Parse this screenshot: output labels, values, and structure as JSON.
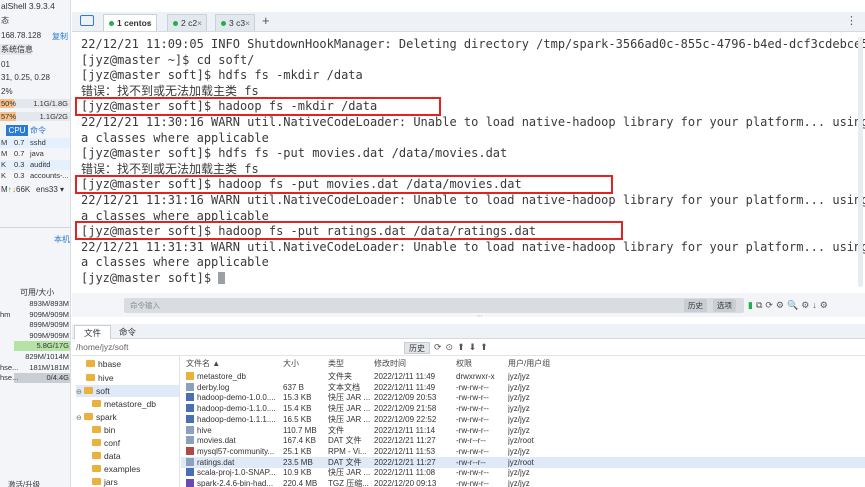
{
  "sidebar": {
    "app_title": "alShell 3.9.3.4",
    "status_label": "态",
    "ip": "168.78.128",
    "copy_label": "复制",
    "sysinfo_label": "系统信息",
    "uptime": "01",
    "load": "31, 0.25, 0.28",
    "cpu_pct": "2%",
    "mem_pct": "50%",
    "mem_val": "1.1G/1.8G",
    "swap_pct": "57%",
    "swap_val": "1.1G/2G",
    "proc_tab_cpu": "CPU",
    "proc_tab_cmd": "命令",
    "processes": [
      {
        "mem": "M",
        "cpu": "0.7",
        "name": "sshd"
      },
      {
        "mem": "M",
        "cpu": "0.7",
        "name": "java"
      },
      {
        "mem": "K",
        "cpu": "0.3",
        "name": "auditd"
      },
      {
        "mem": "K",
        "cpu": "0.3",
        "name": "accounts-..."
      }
    ],
    "net_up": "M",
    "net_down": "66K",
    "net_iface": "ens33",
    "local_label": "本机",
    "disk_header": "可用/大小",
    "disks": [
      {
        "name": "",
        "val": "893M/893M"
      },
      {
        "name": "hm",
        "val": "909M/909M"
      },
      {
        "name": "",
        "val": "899M/909M"
      },
      {
        "name": "",
        "val": "909M/909M"
      },
      {
        "name": "",
        "val": "5.8G/17G"
      },
      {
        "name": "",
        "val": "829M/1014M"
      },
      {
        "name": "hse...",
        "val": "181M/181M"
      },
      {
        "name": "hse...",
        "val": "0/4.4G"
      }
    ],
    "upgrade_label": "激活/升级",
    "colors": {
      "mem_bar": "#f6c08a",
      "swap_bar": "#f6c08a",
      "cpu_tab": "#2a7bd5",
      "disk_bar": "#b5e3a5"
    }
  },
  "tabs": [
    {
      "label": "1 centos",
      "active": true
    },
    {
      "label": "2 c2",
      "active": false
    },
    {
      "label": "3 c3",
      "active": false
    }
  ],
  "terminal": {
    "lines": [
      "22/12/21 11:09:05 INFO ShutdownHookManager: Deleting directory /tmp/spark-3566ad0c-855c-4796-b4ed-dcf3cdebce5a",
      "[jyz@master ~]$ cd soft/",
      "[jyz@master soft]$ hdfs fs -mkdir /data",
      "错误：找不到或无法加载主类 fs",
      "[jyz@master soft]$ hadoop fs -mkdir /data",
      "22/12/21 11:30:16 WARN util.NativeCodeLoader: Unable to load native-hadoop library for your platform... using builtin-j",
      "a classes where applicable",
      "[jyz@master soft]$ hdfs fs -put movies.dat /data/movies.dat",
      "错误：找不到或无法加载主类 fs",
      "[jyz@master soft]$ hadoop fs -put movies.dat /data/movies.dat",
      "22/12/21 11:31:16 WARN util.NativeCodeLoader: Unable to load native-hadoop library for your platform... using builtin-j",
      "a classes where applicable",
      "[jyz@master soft]$ hadoop fs -put ratings.dat /data/ratings.dat",
      "22/12/21 11:31:31 WARN util.NativeCodeLoader: Unable to load native-hadoop library for your platform... using builtin-j",
      "a classes where applicable",
      "[jyz@master soft]$ "
    ],
    "highlight_color": "#e02424"
  },
  "cmdbar": {
    "placeholder": "命令输入",
    "history_label": "历史",
    "options_label": "选项"
  },
  "filepanel": {
    "tab_files": "文件",
    "tab_commands": "命令",
    "path": "/home/jyz/soft",
    "history_label": "历史",
    "tree": [
      {
        "label": "hbase"
      },
      {
        "label": "hive"
      },
      {
        "label": "soft"
      },
      {
        "label": "metastore_db"
      },
      {
        "label": "spark"
      },
      {
        "label": "bin"
      },
      {
        "label": "conf"
      },
      {
        "label": "data"
      },
      {
        "label": "examples"
      },
      {
        "label": "jars"
      }
    ],
    "columns": [
      "文件名 ▲",
      "大小",
      "类型",
      "修改时间",
      "权限",
      "用户/用户组"
    ],
    "files": [
      {
        "name": "metastore_db",
        "size": "",
        "type": "文件夹",
        "mtime": "2022/12/11 11:49",
        "perm": "drwxrwxr-x",
        "owner": "jyz/jyz",
        "icon": "folder"
      },
      {
        "name": "derby.log",
        "size": "637 B",
        "type": "文本文档",
        "mtime": "2022/12/11 11:49",
        "perm": "-rw-rw-r--",
        "owner": "jyz/jyz",
        "icon": "doc"
      },
      {
        "name": "hadoop-demo-1.0.0....",
        "size": "15.3 KB",
        "type": "快压 JAR ...",
        "mtime": "2022/12/09 20:53",
        "perm": "-rw-rw-r--",
        "owner": "jyz/jyz",
        "icon": "jar"
      },
      {
        "name": "hadoop-demo-1.1.0....",
        "size": "15.4 KB",
        "type": "快压 JAR ...",
        "mtime": "2022/12/09 21:58",
        "perm": "-rw-rw-r--",
        "owner": "jyz/jyz",
        "icon": "jar"
      },
      {
        "name": "hadoop-demo-1.1.1....",
        "size": "16.5 KB",
        "type": "快压 JAR ...",
        "mtime": "2022/12/09 22:52",
        "perm": "-rw-rw-r--",
        "owner": "jyz/jyz",
        "icon": "jar"
      },
      {
        "name": "hive",
        "size": "110.7 MB",
        "type": "文件",
        "mtime": "2022/12/11 11:14",
        "perm": "-rw-rw-r--",
        "owner": "jyz/jyz",
        "icon": "doc"
      },
      {
        "name": "movies.dat",
        "size": "167.4 KB",
        "type": "DAT 文件",
        "mtime": "2022/12/21 11:27",
        "perm": "-rw-r--r--",
        "owner": "jyz/root",
        "icon": "doc"
      },
      {
        "name": "mysql57-community...",
        "size": "25.1 KB",
        "type": "RPM - Vi...",
        "mtime": "2022/12/11 11:53",
        "perm": "-rw-rw-r--",
        "owner": "jyz/jyz",
        "icon": "rpm"
      },
      {
        "name": "ratings.dat",
        "size": "23.5 MB",
        "type": "DAT 文件",
        "mtime": "2022/12/21 11:27",
        "perm": "-rw-r--r--",
        "owner": "jyz/root",
        "icon": "doc",
        "selected": true
      },
      {
        "name": "scala-proj-1.0-SNAP...",
        "size": "10.9 KB",
        "type": "快压 JAR ...",
        "mtime": "2022/12/11 11:08",
        "perm": "-rw-rw-r--",
        "owner": "jyz/jyz",
        "icon": "jar"
      },
      {
        "name": "spark-2.4.6-bin-had...",
        "size": "220.4 MB",
        "type": "TGZ 压缩...",
        "mtime": "2022/12/20 09:13",
        "perm": "-rw-rw-r--",
        "owner": "jyz/jyz",
        "icon": "tgz"
      }
    ]
  }
}
